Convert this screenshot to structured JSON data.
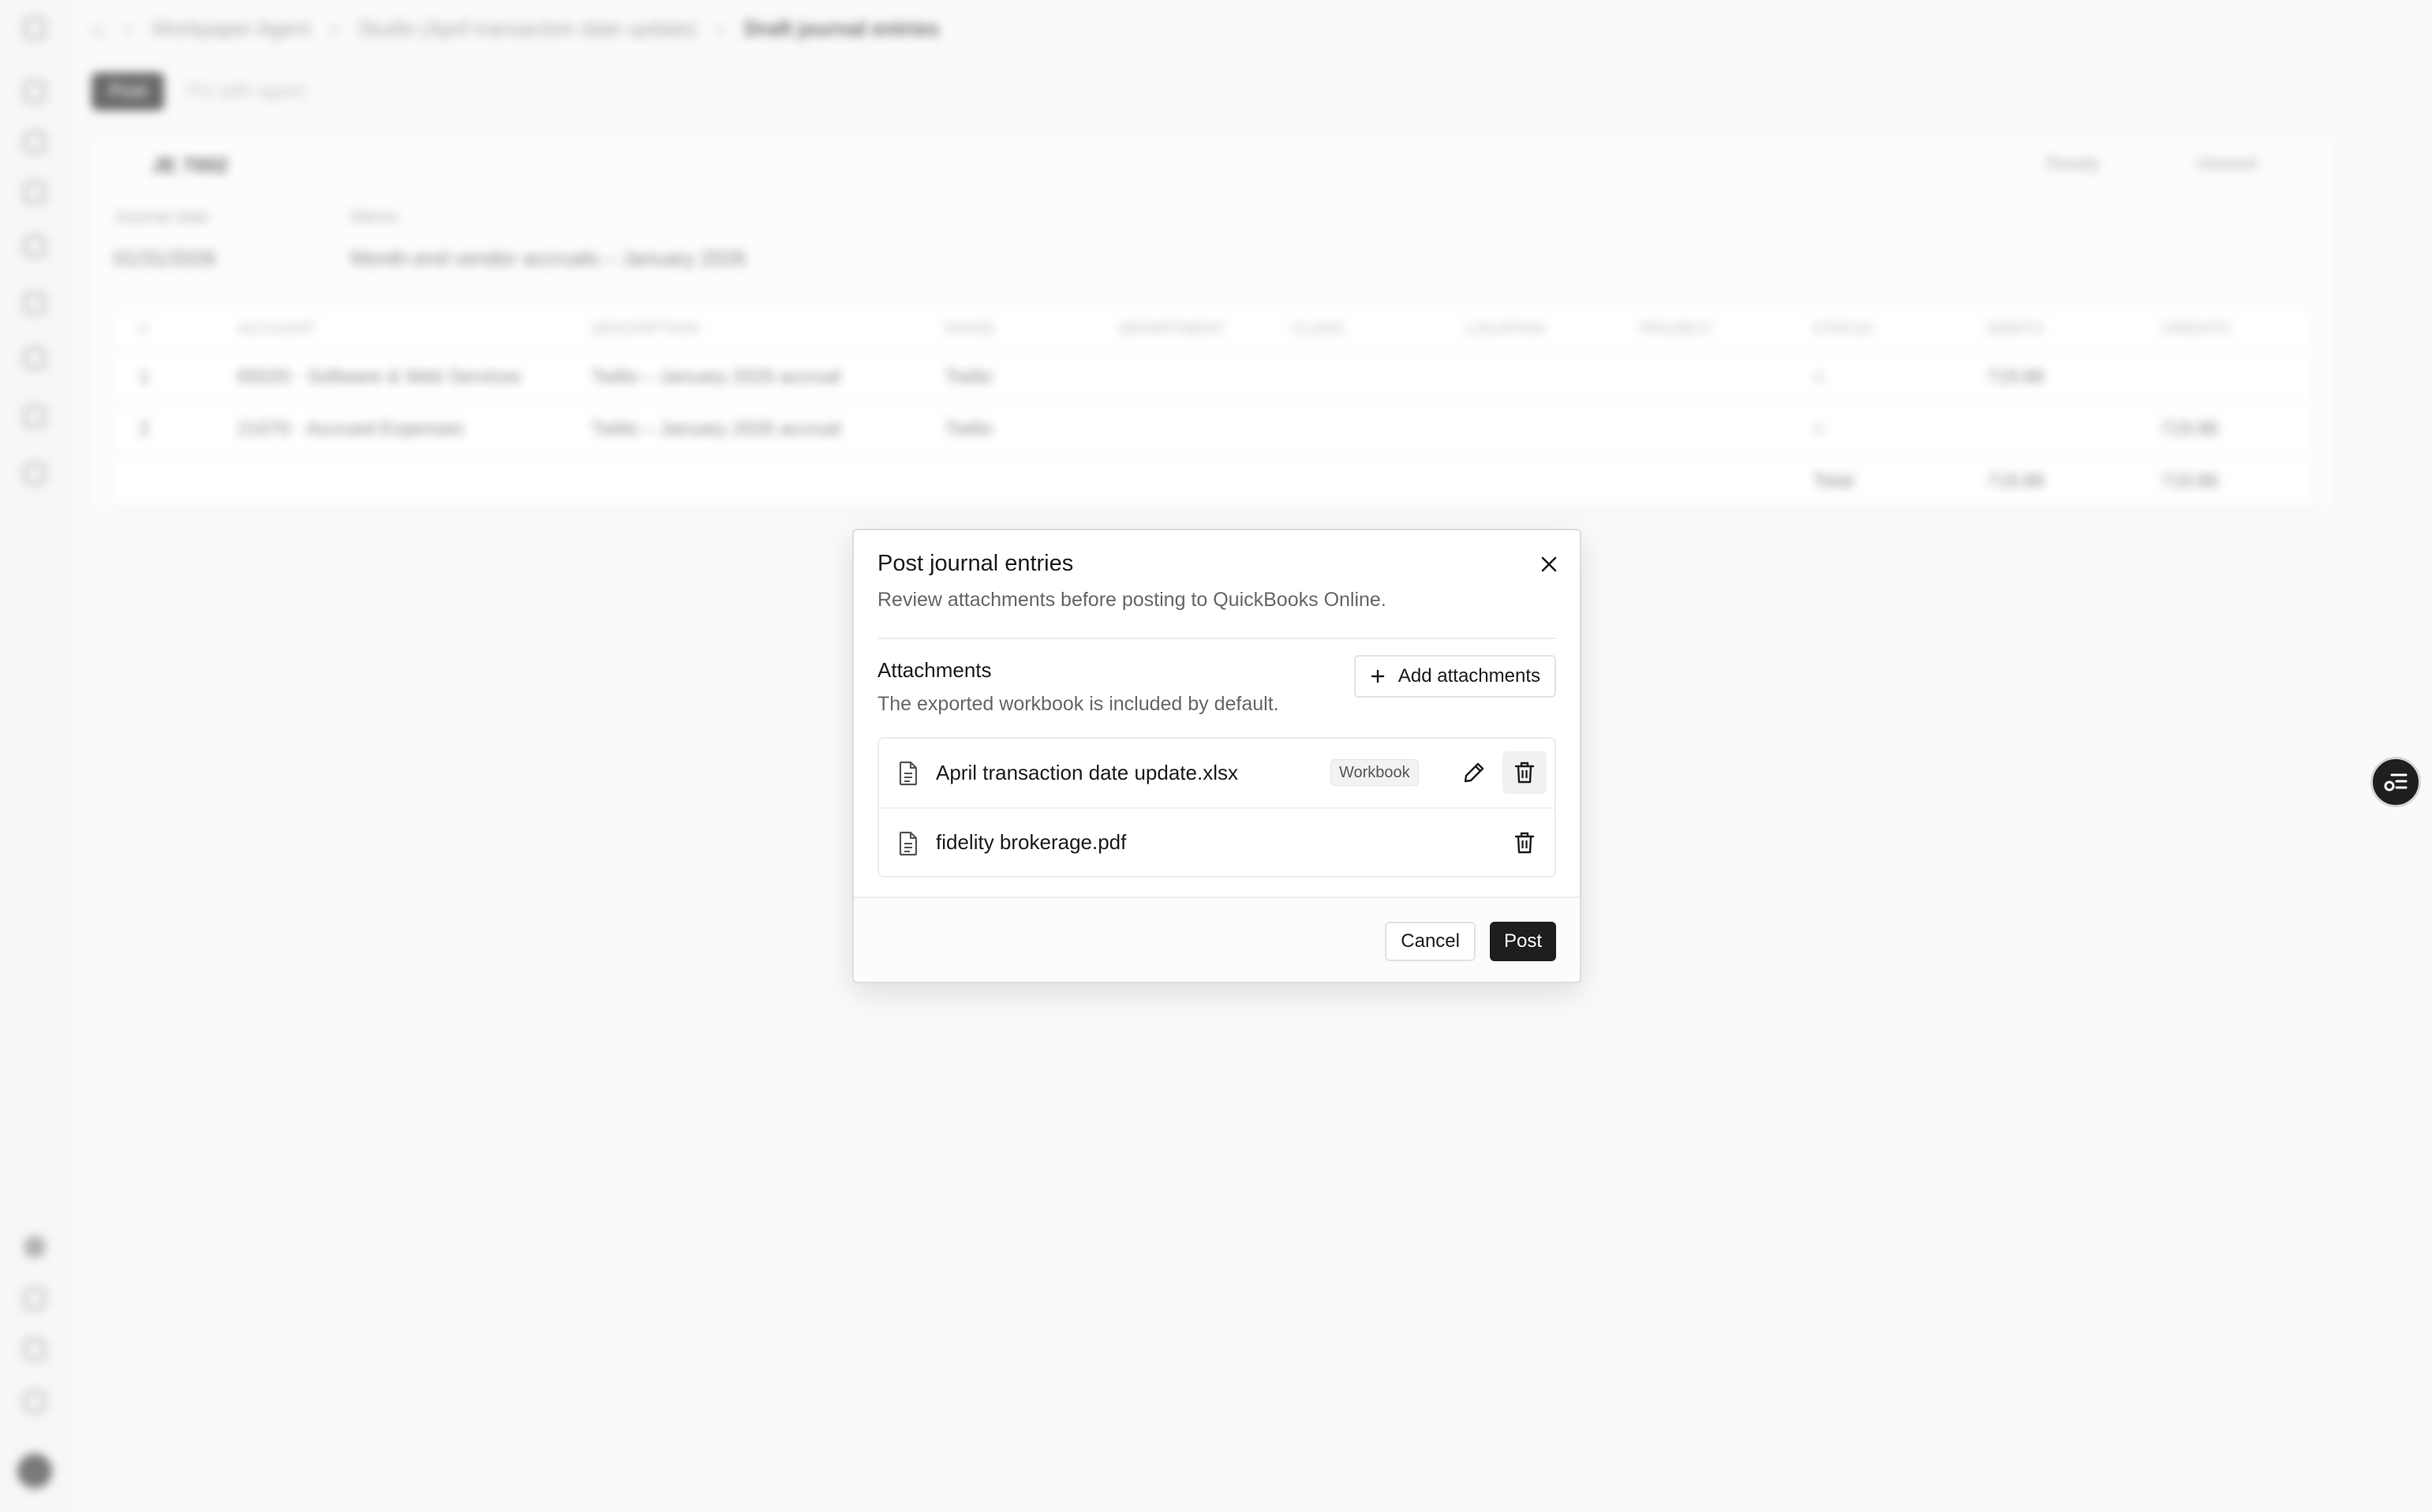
{
  "background": {
    "breadcrumbs": [
      "Workpaper Agent",
      "Studio (April transaction date update)",
      "Draft journal entries"
    ],
    "toolbar": {
      "post_label": "Post",
      "fix_label": "Fix with agent"
    },
    "entry": {
      "id": "JE 7002",
      "status_labels": [
        "Ready",
        "Viewed"
      ],
      "journal_date_label": "Journal date",
      "journal_date": "01/31/2026",
      "memo_label": "Memo",
      "memo": "Month-end vendor accruals – January 2026",
      "columns": [
        "#",
        "ACCOUNT",
        "DESCRIPTION",
        "PAYEE",
        "DEPARTMENT",
        "CLASS",
        "LOCATION",
        "PROJECT",
        "STATUS",
        "DEBITS",
        "CREDITS"
      ],
      "rows": [
        [
          "1",
          "65020 · Software & Web Services",
          "Twilio – January 2026 accrual",
          "Twilio",
          "",
          "",
          "",
          "",
          "○",
          "719.86",
          ""
        ],
        [
          "2",
          "21070 · Accrued Expenses",
          "Twilio – January 2026 accrual",
          "Twilio",
          "",
          "",
          "",
          "",
          "○",
          "",
          "719.86"
        ]
      ],
      "total_label": "Total",
      "total_debits": "719.86",
      "total_credits": "719.86"
    }
  },
  "modal": {
    "title": "Post journal entries",
    "subtitle": "Review attachments before posting to QuickBooks Online.",
    "attachments_title": "Attachments",
    "attachments_subtitle": "The exported workbook is included by default.",
    "add_button": "Add attachments",
    "files": [
      {
        "name": "April transaction date update.xlsx",
        "badge": "Workbook",
        "icon": "file-icon"
      },
      {
        "name": "fidelity brokerage.pdf",
        "icon": "file-icon"
      }
    ],
    "cancel_label": "Cancel",
    "post_label": "Post"
  },
  "icons": {
    "close": "close-icon",
    "add": "plus-icon",
    "edit": "pencil-icon",
    "delete": "trash-icon",
    "fab": "list-settings-icon"
  },
  "colors": {
    "primary_button": "#1e1e1e",
    "overlay": "#ffffff"
  }
}
